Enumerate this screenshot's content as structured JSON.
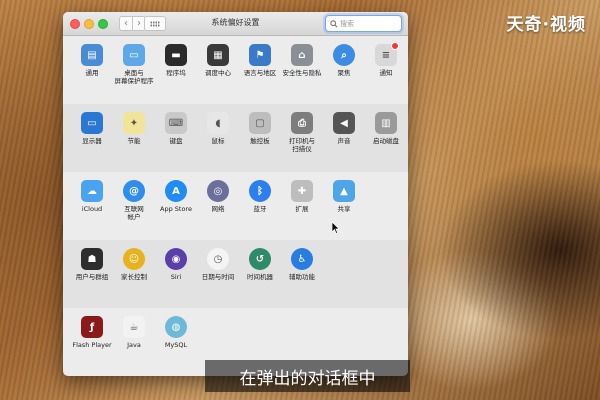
{
  "watermark": "天奇·视频",
  "window": {
    "title": "系统偏好设置",
    "search_placeholder": "搜索",
    "back_label": "‹",
    "forward_label": "›"
  },
  "sections": [
    {
      "items": [
        {
          "label": "通用",
          "icon": "general-icon",
          "color": "#4a8bd6"
        },
        {
          "label": "桌面与\n屏幕保护程序",
          "icon": "desktop-icon",
          "color": "#5fa8e8"
        },
        {
          "label": "程序坞",
          "icon": "dock-icon",
          "color": "#2b2b2b"
        },
        {
          "label": "调度中心",
          "icon": "mission-control-icon",
          "color": "#3a3a3a"
        },
        {
          "label": "语言与地区",
          "icon": "flag-icon",
          "color": "#3b79c9"
        },
        {
          "label": "安全性与隐私",
          "icon": "house-lock-icon",
          "color": "#8a8f96"
        },
        {
          "label": "聚焦",
          "icon": "spotlight-icon",
          "color": "#3c8ce6"
        },
        {
          "label": "通知",
          "icon": "notifications-icon",
          "color": "#d8d8d8"
        }
      ]
    },
    {
      "items": [
        {
          "label": "显示器",
          "icon": "display-icon",
          "color": "#2b78d4"
        },
        {
          "label": "节能",
          "icon": "lightbulb-icon",
          "color": "#f2e39a"
        },
        {
          "label": "键盘",
          "icon": "keyboard-icon",
          "color": "#c9c9c9"
        },
        {
          "label": "鼠标",
          "icon": "mouse-icon",
          "color": "#e6e6e6"
        },
        {
          "label": "触控板",
          "icon": "trackpad-icon",
          "color": "#bdbdbd"
        },
        {
          "label": "打印机与\n扫描仪",
          "icon": "printer-icon",
          "color": "#7d7d7d"
        },
        {
          "label": "声音",
          "icon": "speaker-icon",
          "color": "#555555"
        },
        {
          "label": "启动磁盘",
          "icon": "disk-icon",
          "color": "#9a9a9a"
        }
      ]
    },
    {
      "items": [
        {
          "label": "iCloud",
          "icon": "icloud-icon",
          "color": "#4aa3ef"
        },
        {
          "label": "互联网\n帐户",
          "icon": "at-icon",
          "color": "#2f8df0"
        },
        {
          "label": "App Store",
          "icon": "app-store-icon",
          "color": "#1e8cf2"
        },
        {
          "label": "网络",
          "icon": "network-globe-icon",
          "color": "#6b6f9a"
        },
        {
          "label": "蓝牙",
          "icon": "bluetooth-icon",
          "color": "#2d7ff0"
        },
        {
          "label": "扩展",
          "icon": "puzzle-icon",
          "color": "#bdbdbd"
        },
        {
          "label": "共享",
          "icon": "sharing-folder-icon",
          "color": "#4fa6e6"
        }
      ]
    },
    {
      "items": [
        {
          "label": "用户与群组",
          "icon": "users-icon",
          "color": "#2e2e2e"
        },
        {
          "label": "家长控制",
          "icon": "parental-icon",
          "color": "#e8b21e"
        },
        {
          "label": "Siri",
          "icon": "siri-icon",
          "color": "#5a3fa8"
        },
        {
          "label": "日期与时间",
          "icon": "clock-icon",
          "color": "#f4f4f4"
        },
        {
          "label": "时间机器",
          "icon": "time-machine-icon",
          "color": "#2f8a6a"
        },
        {
          "label": "辅助功能",
          "icon": "accessibility-icon",
          "color": "#2a7de0"
        }
      ]
    },
    {
      "items": [
        {
          "label": "Flash Player",
          "icon": "flash-icon",
          "color": "#8b1a1a"
        },
        {
          "label": "Java",
          "icon": "java-icon",
          "color": "#f2f2f2"
        },
        {
          "label": "MySQL",
          "icon": "mysql-icon",
          "color": "#6fb8d8"
        }
      ]
    }
  ],
  "subtitle": "在弹出的对话框中"
}
